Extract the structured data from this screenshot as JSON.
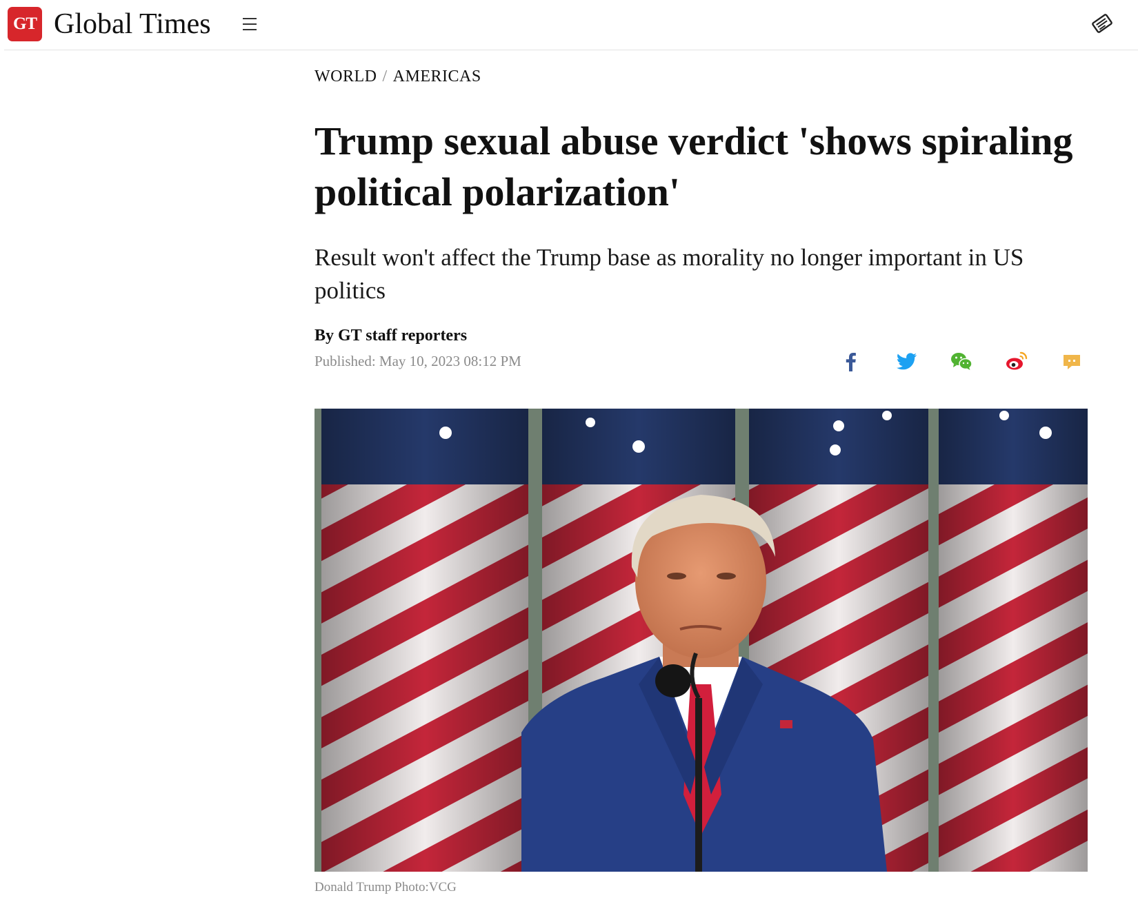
{
  "header": {
    "logo_badge": "GT",
    "site_name": "Global Times",
    "menu_icon": "hamburger-menu-icon",
    "paper_icon": "newspaper-icon"
  },
  "article": {
    "breadcrumb": {
      "section": "WORLD",
      "separator": "/",
      "subsection": "AMERICAS"
    },
    "headline": "Trump sexual abuse verdict 'shows spiraling political polarization'",
    "subheadline": "Result won't affect the Trump base as morality no longer important in US politics",
    "byline": "By GT staff reporters",
    "published": "Published: May 10, 2023 08:12 PM",
    "share": [
      {
        "name": "facebook-share-icon",
        "color": "#3b5998"
      },
      {
        "name": "twitter-share-icon",
        "color": "#1da1f2"
      },
      {
        "name": "wechat-share-icon",
        "color": "#51b332"
      },
      {
        "name": "weibo-share-icon",
        "color": "#e6162d"
      },
      {
        "name": "comment-icon",
        "color": "#f0b64a"
      }
    ],
    "photo_caption": "Donald Trump Photo:VCG"
  },
  "colors": {
    "brand_red": "#d7262b",
    "text": "#111111",
    "muted": "#8a8a8a"
  }
}
